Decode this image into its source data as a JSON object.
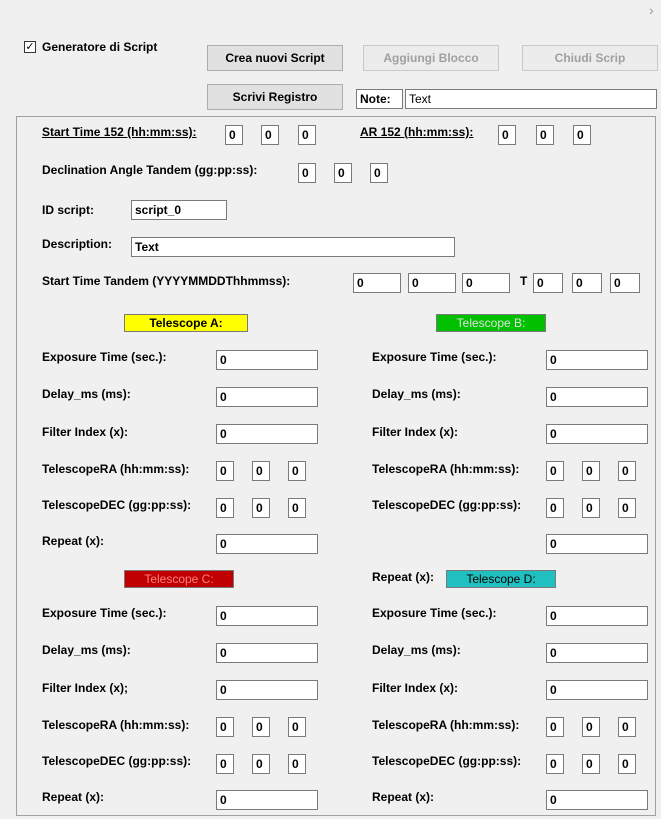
{
  "header": {
    "checkbox_label": "Generatore di Script",
    "checkbox_mark": "✓",
    "create_button": "Crea nuovi Script",
    "add_block_button": "Aggiungi Blocco",
    "close_button": "Chiudi Scrip",
    "write_log_button": "Scrivi Registro",
    "note_label": "Note:",
    "note_value": "Text",
    "chevron": "›"
  },
  "form": {
    "start_time_label": "Start Time 152 (hh:mm:ss):",
    "start_time": [
      "0",
      "0",
      "0"
    ],
    "ar_label": "AR 152 (hh:mm:ss):",
    "ar": [
      "0",
      "0",
      "0"
    ],
    "declination_label": "Declination Angle Tandem  (gg:pp:ss):",
    "declination": [
      "0",
      "0",
      "0"
    ],
    "id_label": "ID script:",
    "id_value": "script_0",
    "description_label": "Description:",
    "description_value": "Text",
    "tandem_label": "Start Time Tandem (YYYYMMDDThhmmss):",
    "tandem_date": [
      "0",
      "0",
      "0"
    ],
    "tandem_t": "T",
    "tandem_time": [
      "0",
      "0",
      "0"
    ]
  },
  "telescopes": {
    "a": {
      "title": "Telescope A:",
      "color": "#ffff00",
      "text_color": "#000000",
      "exposure_label": "Exposure Time (sec.):",
      "exposure": "0",
      "delay_label": "Delay_ms (ms):",
      "delay": "0",
      "filter_label": "Filter Index (x):",
      "filter": "0",
      "ra_label": "TelescopeRA (hh:mm:ss):",
      "ra": [
        "0",
        "0",
        "0"
      ],
      "dec_label": "TelescopeDEC (gg:pp:ss):",
      "dec": [
        "0",
        "0",
        "0"
      ],
      "repeat_label": "Repeat (x):",
      "repeat": "0"
    },
    "b": {
      "title": "Telescope B:",
      "color": "#00c000",
      "text_color": "#e0e0e0",
      "exposure_label": "Exposure Time (sec.):",
      "exposure": "0",
      "delay_label": "Delay_ms (ms):",
      "delay": "0",
      "filter_label": "Filter Index (x):",
      "filter": "0",
      "ra_label": "TelescopeRA (hh:mm:ss):",
      "ra": [
        "0",
        "0",
        "0"
      ],
      "dec_label": "TelescopeDEC (gg:pp:ss):",
      "dec": [
        "0",
        "0",
        "0"
      ],
      "repeat_label": "Repeat (x):",
      "repeat": "0"
    },
    "c": {
      "title": "Telescope C:",
      "color": "#c00000",
      "text_color": "#ff8080",
      "exposure_label": "Exposure Time (sec.):",
      "exposure": "0",
      "delay_label": "Delay_ms (ms):",
      "delay": "0",
      "filter_label": "Filter Index (x);",
      "filter": "0",
      "ra_label": "TelescopeRA (hh:mm:ss):",
      "ra": [
        "0",
        "0",
        "0"
      ],
      "dec_label": "TelescopeDEC (gg:pp:ss):",
      "dec": [
        "0",
        "0",
        "0"
      ],
      "repeat_label": "Repeat (x):",
      "repeat": "0"
    },
    "d": {
      "title": "Telescope D:",
      "color": "#20c0c0",
      "text_color": "#000000",
      "exposure_label": "Exposure Time (sec.):",
      "exposure": "0",
      "delay_label": "Delay_ms (ms):",
      "delay": "0",
      "filter_label": "Filter Index (x):",
      "filter": "0",
      "ra_label": "TelescopeRA (hh:mm:ss):",
      "ra": [
        "0",
        "0",
        "0"
      ],
      "dec_label": "TelescopeDEC (gg:pp:ss):",
      "dec": [
        "0",
        "0",
        "0"
      ],
      "repeat_label": "Repeat (x):",
      "repeat": "0"
    }
  }
}
